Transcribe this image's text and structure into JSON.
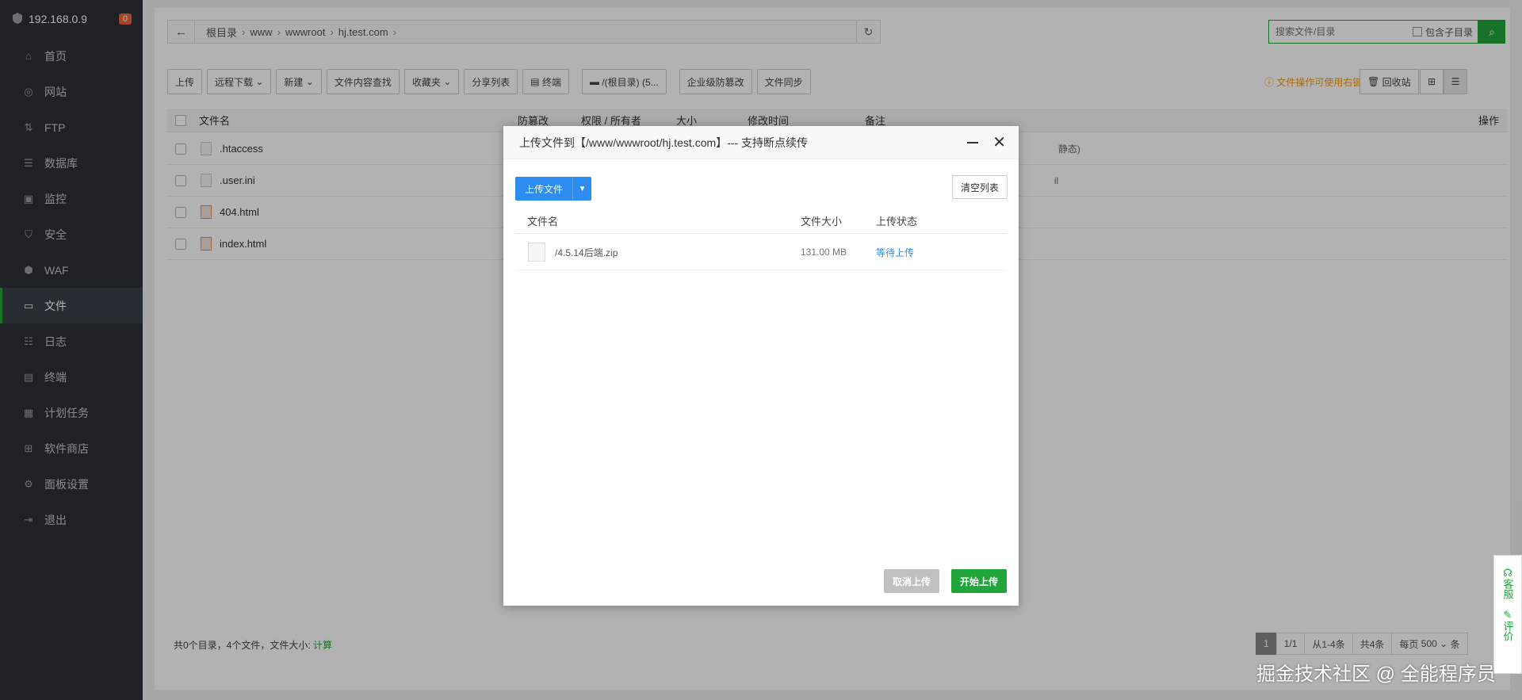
{
  "sidebar": {
    "ip": "192.168.0.9",
    "badge": "0",
    "items": [
      {
        "label": "首页",
        "icon": "home-icon"
      },
      {
        "label": "网站",
        "icon": "globe-icon"
      },
      {
        "label": "FTP",
        "icon": "ftp-icon"
      },
      {
        "label": "数据库",
        "icon": "database-icon"
      },
      {
        "label": "监控",
        "icon": "monitor-icon"
      },
      {
        "label": "安全",
        "icon": "shield-icon"
      },
      {
        "label": "WAF",
        "icon": "waf-icon"
      },
      {
        "label": "文件",
        "icon": "folder-icon",
        "active": true
      },
      {
        "label": "日志",
        "icon": "log-icon"
      },
      {
        "label": "终端",
        "icon": "terminal-icon"
      },
      {
        "label": "计划任务",
        "icon": "calendar-icon"
      },
      {
        "label": "软件商店",
        "icon": "grid-icon"
      },
      {
        "label": "面板设置",
        "icon": "gear-icon"
      },
      {
        "label": "退出",
        "icon": "logout-icon"
      }
    ]
  },
  "path": {
    "crumbs": [
      "根目录",
      "www",
      "wwwroot",
      "hj.test.com"
    ]
  },
  "search": {
    "placeholder": "搜索文件/目录",
    "include_sub": "包含子目录"
  },
  "toolbar": {
    "upload": "上传",
    "remote_download": "远程下载",
    "new": "新建",
    "content_search": "文件内容查找",
    "favorites": "收藏夹",
    "share_list": "分享列表",
    "terminal": "终端",
    "root_dir": "/(根目录) (5...",
    "tamper_proof": "企业级防篡改",
    "file_sync": "文件同步",
    "tip": "文件操作可使用右键",
    "recycle": "回收站"
  },
  "table": {
    "headers": {
      "name": "文件名",
      "tamper": "防篡改",
      "perm": "权限 / 所有者",
      "size": "大小",
      "mtime": "修改时间",
      "remark": "备注",
      "ops": "操作"
    },
    "rows": [
      {
        "name": ".htaccess",
        "type": "file",
        "remark_tail": "静态)"
      },
      {
        "name": ".user.ini",
        "type": "file",
        "remark_tail": "il"
      },
      {
        "name": "404.html",
        "type": "html",
        "remark_tail": ""
      },
      {
        "name": "index.html",
        "type": "html",
        "remark_tail": ""
      }
    ]
  },
  "footer": {
    "summary": "共0个目录，4个文件，文件大小:",
    "calc": "计算"
  },
  "pager": {
    "current": "1",
    "pages": "1/1",
    "range": "从1-4条",
    "total": "共4条",
    "per_page_label": "每页",
    "per_page": "500",
    "unit": "条"
  },
  "dialog": {
    "title": "上传文件到【/www/wwwroot/hj.test.com】--- 支持断点续传",
    "upload_btn": "上传文件",
    "clear_btn": "清空列表",
    "headers": {
      "name": "文件名",
      "size": "文件大小",
      "status": "上传状态"
    },
    "files": [
      {
        "name": "/4.5.14后端.zip",
        "size": "131.00 MB",
        "status": "等待上传"
      }
    ],
    "cancel": "取消上传",
    "start": "开始上传"
  },
  "float": {
    "service": "客服",
    "review": "评价"
  },
  "watermark": "掘金技术社区 @ 全能程序员"
}
